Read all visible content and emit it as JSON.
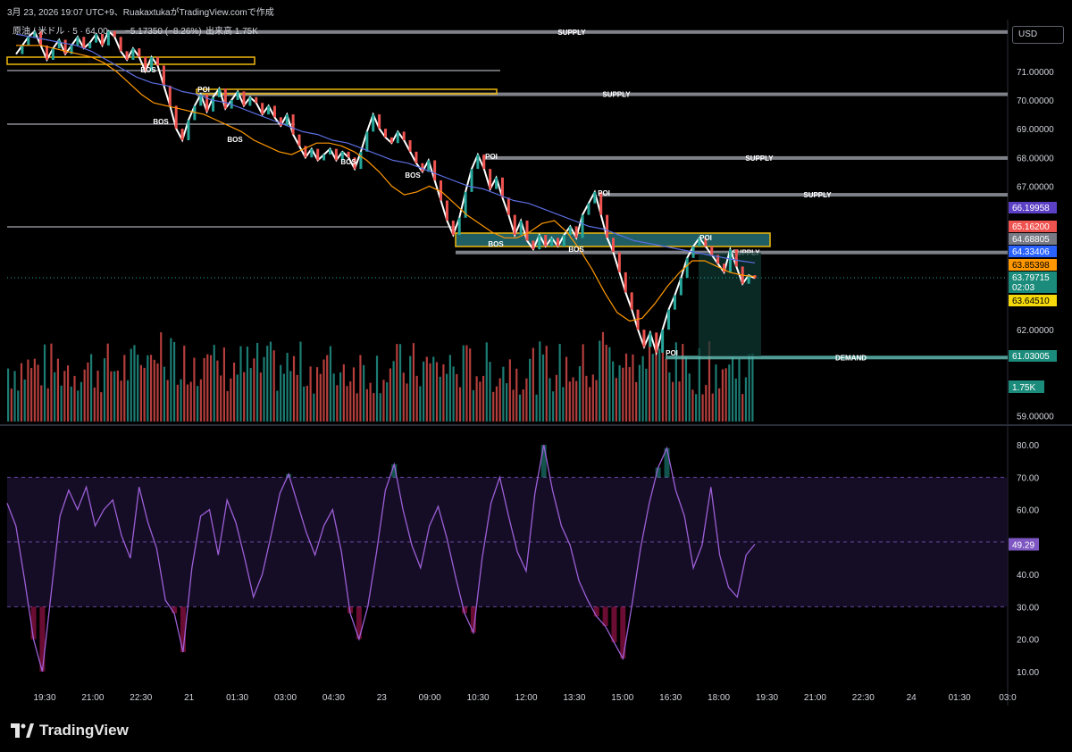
{
  "header": {
    "text": "3月 23, 2026 19:07 UTC+9、RuakaxtukaがTradingView.comで作成"
  },
  "legend": {
    "text": "原油 / 米ドル · 5 · 64.00",
    "change": "−5.17350 (−8.26%)",
    "volume_label": "出来高 1.75K"
  },
  "currency_button": "USD",
  "brand": {
    "name": "TradingView",
    "logo": "tradingview-logo-icon"
  },
  "colors": {
    "up": "#26a69a",
    "down": "#ef5350",
    "background": "#000000",
    "sma_fast": "#ff9800",
    "sma_slow": "#5b6ee1",
    "zone_border": "#f0b90b",
    "zone_fill": "#1f5f64",
    "rsi_line": "#9c5fd6"
  },
  "chart_data": [
    {
      "type": "line",
      "panel": "price",
      "y_ticks": [
        "71.00000",
        "70.00000",
        "69.00000",
        "68.00000",
        "67.00000",
        "62.00000",
        "59.00000"
      ],
      "x_ticks": [
        "19:30",
        "21:00",
        "22:30",
        "21",
        "01:30",
        "03:00",
        "04:30",
        "23",
        "09:00",
        "10:30",
        "12:00",
        "13:30",
        "15:00",
        "16:30",
        "18:00",
        "19:30",
        "21:00",
        "22:30",
        "24",
        "01:30",
        "03:0"
      ],
      "ylim": [
        58.8,
        72.8
      ],
      "price_series": [
        71.6,
        71.9,
        72.2,
        72.4,
        71.9,
        71.4,
        71.8,
        72.1,
        71.6,
        71.9,
        72.2,
        71.8,
        72.0,
        72.3,
        71.9,
        72.4,
        72.2,
        71.7,
        71.4,
        71.8,
        71.5,
        71.0,
        71.5,
        71.2,
        70.5,
        69.8,
        69.0,
        68.6,
        69.3,
        69.8,
        70.2,
        69.6,
        70.1,
        70.4,
        69.7,
        70.0,
        70.3,
        69.8,
        70.1,
        69.9,
        69.5,
        69.8,
        69.4,
        69.1,
        69.5,
        68.8,
        68.4,
        68.0,
        68.3,
        67.9,
        68.1,
        68.3,
        67.9,
        68.2,
        68.0,
        67.6,
        68.2,
        68.9,
        69.5,
        69.0,
        68.7,
        68.5,
        68.9,
        68.6,
        68.2,
        67.8,
        67.5,
        67.9,
        67.2,
        66.5,
        65.8,
        65.3,
        65.9,
        66.8,
        67.6,
        68.1,
        67.6,
        66.9,
        67.3,
        66.6,
        66.0,
        65.3,
        65.8,
        65.1,
        64.8,
        65.3,
        64.9,
        65.2,
        64.9,
        65.3,
        65.6,
        65.2,
        66.0,
        66.4,
        66.8,
        66.0,
        65.2,
        64.7,
        64.0,
        63.3,
        62.7,
        62.0,
        61.4,
        61.9,
        61.2,
        62.0,
        62.7,
        63.2,
        63.8,
        64.5,
        64.9,
        65.2,
        64.9,
        64.6,
        64.3,
        64.0,
        64.8,
        64.2,
        63.6,
        63.9,
        63.79
      ],
      "fast_ma": [
        71.9,
        71.9,
        71.9,
        71.8,
        71.7,
        71.6,
        71.5,
        71.3,
        71.0,
        70.6,
        70.2,
        69.9,
        69.8,
        69.7,
        69.6,
        69.5,
        69.3,
        69.1,
        68.9,
        68.6,
        68.4,
        68.2,
        68.1,
        68.3,
        68.5,
        68.5,
        68.4,
        68.2,
        67.9,
        67.5,
        67.0,
        66.7,
        66.8,
        67.0,
        66.8,
        66.4,
        66.0,
        65.7,
        65.4,
        65.2,
        65.2,
        65.4,
        65.7,
        65.8,
        65.4,
        64.8,
        64.1,
        63.3,
        62.6,
        62.3,
        62.4,
        62.9,
        63.5,
        64.0,
        64.4,
        64.4,
        64.2,
        64.0,
        63.9,
        63.85
      ],
      "slow_ma": [
        72.3,
        72.2,
        72.1,
        72.0,
        71.9,
        71.7,
        71.4,
        71.1,
        70.8,
        70.6,
        70.5,
        70.3,
        70.2,
        70.0,
        69.9,
        69.7,
        69.5,
        69.3,
        69.1,
        68.9,
        68.8,
        68.6,
        68.5,
        68.3,
        68.1,
        67.9,
        67.8,
        67.6,
        67.4,
        67.2,
        67.0,
        66.9,
        66.7,
        66.5,
        66.4,
        66.2,
        66.0,
        65.8,
        65.6,
        65.5,
        65.3,
        65.1,
        65.0,
        64.9,
        64.8,
        64.7,
        64.6,
        64.5,
        64.4,
        64.33
      ],
      "zones": [
        {
          "kind": "SUPPLY",
          "label": "SUPPLY",
          "price": 72.37
        },
        {
          "kind": "SUPPLY",
          "label": "SUPPLY",
          "price": 70.2
        },
        {
          "kind": "SUPPLY",
          "label": "SUPPLY",
          "price": 67.98
        },
        {
          "kind": "SUPPLY",
          "label": "SUPPLY",
          "price": 66.7
        },
        {
          "kind": "SUPPLY",
          "label": "SUPPLY",
          "price": 64.69
        },
        {
          "kind": "DEMAND",
          "label": "DEMAND",
          "price": 61.03
        }
      ],
      "annotations": [
        "POI",
        "POI",
        "POI",
        "POI",
        "POI",
        "BOS",
        "BOS",
        "BOS",
        "BOS",
        "BOS",
        "BOS",
        "BOS"
      ],
      "price_badges": [
        {
          "value": "66.19958",
          "color": "#5b3fc4"
        },
        {
          "value": "65.16200",
          "color": "#ef5350"
        },
        {
          "value": "64.68805",
          "color": "#787b86"
        },
        {
          "value": "64.33406",
          "color": "#2962ff"
        },
        {
          "value": "63.85398",
          "color": "#ff9800"
        },
        {
          "value": "63.79715",
          "sub": "02:03",
          "color": "#1b8c7b"
        },
        {
          "value": "63.64510",
          "color": "#f5d90a"
        },
        {
          "value": "61.03005",
          "color": "#1b8c7b"
        }
      ],
      "volume_badge": "1.75K"
    },
    {
      "type": "line",
      "panel": "rsi",
      "y_ticks": [
        "80.00",
        "70.00",
        "60.00",
        "50.00",
        "40.00",
        "30.00",
        "20.00",
        "10.00"
      ],
      "ylim": [
        5,
        85
      ],
      "bands": [
        30,
        70
      ],
      "current_value": "49.29",
      "values": [
        62,
        55,
        38,
        20,
        10,
        34,
        58,
        66,
        60,
        67,
        55,
        60,
        63,
        52,
        45,
        67,
        56,
        48,
        32,
        28,
        16,
        42,
        58,
        60,
        46,
        63,
        56,
        45,
        33,
        40,
        52,
        65,
        71,
        62,
        53,
        46,
        55,
        60,
        47,
        28,
        20,
        30,
        47,
        66,
        74,
        60,
        49,
        42,
        55,
        61,
        51,
        39,
        28,
        22,
        45,
        62,
        70,
        58,
        47,
        41,
        65,
        80,
        66,
        55,
        49,
        38,
        32,
        27,
        24,
        19,
        14,
        30,
        48,
        62,
        73,
        79,
        66,
        58,
        42,
        49,
        67,
        46,
        36,
        33,
        46,
        49.29
      ]
    }
  ]
}
